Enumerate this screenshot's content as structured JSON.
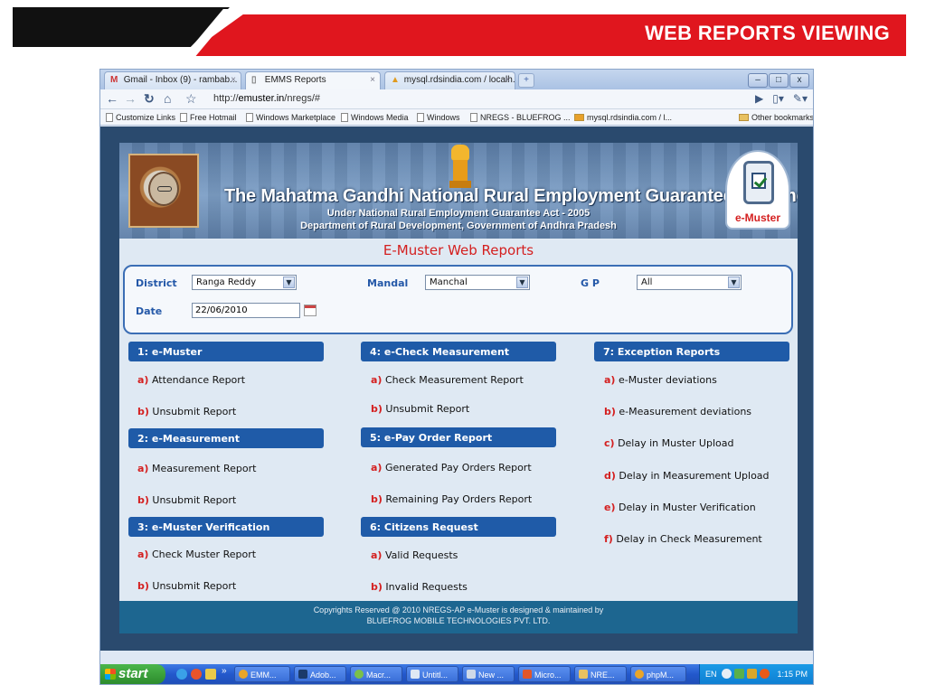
{
  "slide": {
    "title": "WEB REPORTS VIEWING"
  },
  "browser": {
    "tabs": [
      {
        "label": "Gmail - Inbox (9) - rambab...",
        "icon": "gmail-icon"
      },
      {
        "label": "EMMS Reports",
        "icon": "page-icon"
      },
      {
        "label": "mysql.rdsindia.com / localh...",
        "icon": "phpmyadmin-icon"
      }
    ],
    "new_tab_glyph": "+",
    "url_prefix": "http://",
    "url_host": "emuster.in",
    "url_path": "/nregs/#",
    "bookmarks": [
      {
        "label": "Customize Links",
        "icon": "page-icon"
      },
      {
        "label": "Free Hotmail",
        "icon": "page-icon"
      },
      {
        "label": "Windows Marketplace",
        "icon": "page-icon"
      },
      {
        "label": "Windows Media",
        "icon": "page-icon"
      },
      {
        "label": "Windows",
        "icon": "page-icon"
      },
      {
        "label": "NREGS - BLUEFROG ...",
        "icon": "page-icon"
      },
      {
        "label": "mysql.rdsindia.com / l...",
        "icon": "phpmyadmin-icon"
      }
    ],
    "other_bookmarks": "Other bookmarks"
  },
  "banner": {
    "title": "The Mahatma Gandhi National Rural Employment Guarantee Scheme",
    "subtitle1": "Under National Rural Employment Guarantee Act - 2005",
    "subtitle2": "Department of Rural Development, Government of Andhra Pradesh",
    "logo_text": "e-Muster"
  },
  "page_title": "E-Muster Web Reports",
  "filters": {
    "district_label": "District",
    "district_value": "Ranga Reddy",
    "mandal_label": "Mandal",
    "mandal_value": "Manchal",
    "gp_label": "G P",
    "gp_value": "All",
    "date_label": "Date",
    "date_value": "22/06/2010"
  },
  "sections": {
    "s1": {
      "title": "1: e-Muster",
      "items": [
        {
          "letter": "a)",
          "label": "Attendance Report"
        },
        {
          "letter": "b)",
          "label": "Unsubmit Report"
        }
      ]
    },
    "s2": {
      "title": "2: e-Measurement",
      "items": [
        {
          "letter": "a)",
          "label": "Measurement Report"
        },
        {
          "letter": "b)",
          "label": "Unsubmit Report"
        }
      ]
    },
    "s3": {
      "title": "3: e-Muster Verification",
      "items": [
        {
          "letter": "a)",
          "label": "Check Muster Report"
        },
        {
          "letter": "b)",
          "label": "Unsubmit Report"
        }
      ]
    },
    "s4": {
      "title": "4: e-Check Measurement",
      "items": [
        {
          "letter": "a)",
          "label": "Check Measurement Report"
        },
        {
          "letter": "b)",
          "label": "Unsubmit Report"
        }
      ]
    },
    "s5": {
      "title": "5: e-Pay Order Report",
      "items": [
        {
          "letter": "a)",
          "label": "Generated Pay Orders Report"
        },
        {
          "letter": "b)",
          "label": "Remaining Pay Orders Report"
        }
      ]
    },
    "s6": {
      "title": "6: Citizens Request",
      "items": [
        {
          "letter": "a)",
          "label": "Valid Requests"
        },
        {
          "letter": "b)",
          "label": "Invalid Requests"
        }
      ]
    },
    "s7": {
      "title": "7: Exception Reports",
      "items": [
        {
          "letter": "a)",
          "label": "e-Muster deviations"
        },
        {
          "letter": "b)",
          "label": "e-Measurement deviations"
        },
        {
          "letter": "c)",
          "label": "Delay in Muster Upload"
        },
        {
          "letter": "d)",
          "label": "Delay in Measurement Upload"
        },
        {
          "letter": "e)",
          "label": "Delay in Muster Verification"
        },
        {
          "letter": "f)",
          "label": "Delay in Check Measurement"
        }
      ]
    }
  },
  "footer": {
    "line1": "Copyrights Reserved @ 2010 NREGS-AP e-Muster is designed & maintained by",
    "line2": "BLUEFROG MOBILE TECHNOLOGIES PVT. LTD."
  },
  "taskbar": {
    "start_label": "start",
    "overflow_glyph": "»",
    "tasks": [
      "EMM...",
      "Adob...",
      "Macr...",
      "Untitl...",
      "New ...",
      "Micro...",
      "NRE...",
      "phpM..."
    ],
    "lang": "EN",
    "clock": "1:15 PM"
  }
}
